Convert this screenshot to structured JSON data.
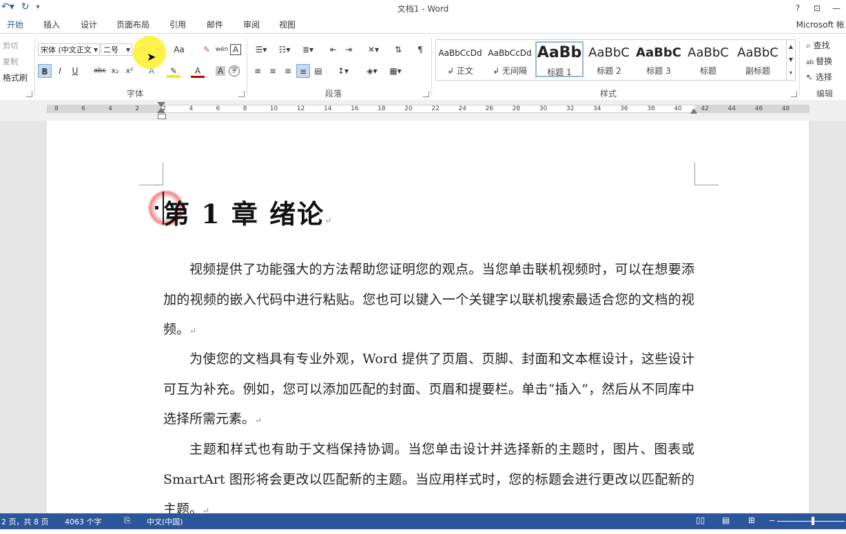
{
  "titlebar": {
    "title": "文档1 - Word",
    "help": "?",
    "restore": "⊡",
    "minimize": "—"
  },
  "tabs": [
    {
      "label": "开始",
      "active": true
    },
    {
      "label": "插入"
    },
    {
      "label": "设计"
    },
    {
      "label": "页面布局"
    },
    {
      "label": "引用"
    },
    {
      "label": "邮件"
    },
    {
      "label": "审阅"
    },
    {
      "label": "视图"
    }
  ],
  "account": "Microsoft 帐",
  "clipboard": {
    "cut": "剪切",
    "copy": "复制",
    "format_painter": "格式刷"
  },
  "font": {
    "name": "宋体 (中文正文",
    "size": "二号",
    "group_label": "字体",
    "bold": "B",
    "italic": "I",
    "underline": "U",
    "strike": "abc",
    "subscript": "x₂",
    "superscript": "x²",
    "grow": "A",
    "shrink": "A",
    "case": "Aa",
    "phonetic": "wén",
    "border_char": "A",
    "color_a": "A",
    "shade_a": "A",
    "circle": "字"
  },
  "paragraph": {
    "group_label": "段落"
  },
  "styles": {
    "group_label": "样式",
    "items": [
      {
        "preview": "AaBbCcDd",
        "name": "↲ 正文"
      },
      {
        "preview": "AaBbCcDd",
        "name": "↲ 无间隔"
      },
      {
        "preview": "AaBb",
        "name": "标题 1"
      },
      {
        "preview": "AaBbC",
        "name": "标题 2"
      },
      {
        "preview": "AaBbC",
        "name": "标题 3"
      },
      {
        "preview": "AaBbC",
        "name": "标题"
      },
      {
        "preview": "AaBbC",
        "name": "副标题"
      }
    ]
  },
  "editing": {
    "find": "查找",
    "replace": "替换",
    "select": "选择",
    "group_label": "编辑"
  },
  "ruler": {
    "ticks": [
      "8",
      "6",
      "4",
      "2",
      "2",
      "4",
      "6",
      "8",
      "10",
      "12",
      "14",
      "16",
      "18",
      "20",
      "22",
      "24",
      "26",
      "28",
      "30",
      "32",
      "34",
      "36",
      "38",
      "40",
      "42",
      "44",
      "46",
      "48"
    ]
  },
  "document": {
    "heading": "第 1 章  绪论",
    "paragraphs": [
      "视频提供了功能强大的方法帮助您证明您的观点。当您单击联机视频时，可以在想要添加的视频的嵌入代码中进行粘贴。您也可以键入一个关键字以联机搜索最适合您的文档的视频。",
      "为使您的文档具有专业外观，Word 提供了页眉、页脚、封面和文本框设计，这些设计可互为补充。例如，您可以添加匹配的封面、页眉和提要栏。单击“插入”，然后从不同库中选择所需元素。",
      "主题和样式也有助于文档保持协调。当您单击设计并选择新的主题时，图片、图表或 SmartArt 图形将会更改以匹配新的主题。当应用样式时，您的标题会进行更改以匹配新的主题。"
    ],
    "para_mark": "↵"
  },
  "status": {
    "page": "2 页，共 8 页",
    "words": "4063 个字",
    "lang": "中文(中国)"
  },
  "colors": {
    "accent": "#2b579a",
    "highlight": "#ffe600",
    "font_color": "#c00000"
  }
}
